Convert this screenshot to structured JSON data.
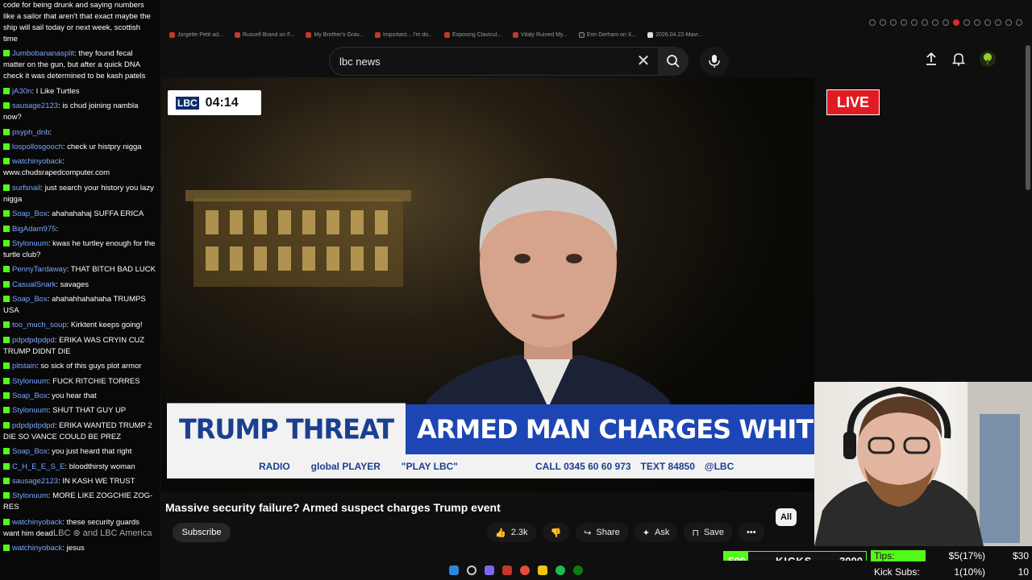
{
  "browser": {
    "bookmarks": [
      "Jorgette Petit ad...",
      "Russell Brand on F...",
      "My Brother's Grav...",
      "Important... I'm do...",
      "Exposing Clavicul...",
      "Vitaly Ruined My...",
      "Erin Derham on X...",
      "2026.04.22-Mavr..."
    ]
  },
  "search": {
    "query": "lbc news"
  },
  "video": {
    "lbc_logo": "LBC",
    "timer": "04:14",
    "live_label": "LIVE",
    "lower_third": {
      "tag": "TRUMP THREAT",
      "headline": "ARMED MAN CHARGES WHITE HOUSE DI",
      "radio": "RADIO",
      "player": "global PLAYER",
      "play": "\"PLAY LBC\"",
      "call": "CALL 0345 60 60 973",
      "text": "TEXT 84850",
      "handle": "@LBC"
    }
  },
  "title": "Massive security failure? Armed suspect charges Trump event",
  "channel": "LBC ⊛ and LBC America",
  "actions": {
    "subscribe": "Subscribe",
    "likes": "2.3k",
    "share": "Share",
    "ask": "Ask",
    "save": "Save",
    "filter_all": "All"
  },
  "chat": [
    {
      "user": "",
      "text": "code for being drunk and saying numbers like a sailor that aren't that exact maybe the ship will sail today or next week, scottish time",
      "badge": false
    },
    {
      "user": "Jumbobananasplit",
      "text": "they found fecal matter on the gun, but after a quick DNA check it was determined to be kash patels",
      "badge": true
    },
    {
      "user": "jA30n",
      "text": "I Like Turtles",
      "badge": true
    },
    {
      "user": "sausage2123",
      "text": "is chud joining nambla now?",
      "badge": true
    },
    {
      "user": "psyph_dnb",
      "text": "",
      "badge": true
    },
    {
      "user": "lospollosgooch",
      "text": "check ur histpry nigga",
      "badge": true
    },
    {
      "user": "watchinyoback",
      "text": "www.chudsrapedcomputer.com",
      "badge": true
    },
    {
      "user": "surfsnail",
      "text": "just search your history you lazy nigga",
      "badge": true
    },
    {
      "user": "Soap_Box",
      "text": "ahahahahaj SUFFA ERICA",
      "badge": true
    },
    {
      "user": "BigAdam975",
      "text": "",
      "badge": true
    },
    {
      "user": "Stylonuum",
      "text": "kwas he turtley enough for the turtle club?",
      "badge": true
    },
    {
      "user": "PennyTardaway",
      "text": "THAT BITCH BAD LUCK",
      "badge": true
    },
    {
      "user": "CasualSnark",
      "text": "savages",
      "badge": true
    },
    {
      "user": "Soap_Box",
      "text": "ahahahhahahaha TRUMPS USA",
      "badge": true
    },
    {
      "user": "too_much_soup",
      "text": "Kirktent keeps going!",
      "badge": true
    },
    {
      "user": "pdpdpdpdpd",
      "text": "ERIKA WAS CRYIN CUZ TRUMP DIDNT DIE",
      "badge": true
    },
    {
      "user": "pitstain",
      "text": "so sick of this guys plot armor",
      "badge": true
    },
    {
      "user": "Stylonuum",
      "text": "FUCK RITCHIE TORRES",
      "badge": true
    },
    {
      "user": "Soap_Box",
      "text": "you hear that",
      "badge": true
    },
    {
      "user": "Stylonuum",
      "text": "SHUT THAT GUY UP",
      "badge": true
    },
    {
      "user": "pdpdpdpdpd",
      "text": "ERIKA WANTED TRUMP 2 DIE SO VANCE COULD BE PREZ",
      "badge": true
    },
    {
      "user": "Soap_Box",
      "text": "you just heard that right",
      "badge": true
    },
    {
      "user": "C_H_E_E_S_E",
      "text": "bloodthirsty woman",
      "badge": true
    },
    {
      "user": "sausage2123",
      "text": "IN KASH WE TRUST",
      "badge": true
    },
    {
      "user": "Stylonuum",
      "text": "MORE LIKE ZOGCHIE ZOG-RES",
      "badge": true
    },
    {
      "user": "watchinyoback",
      "text": "these security guards want him dead",
      "badge": true
    },
    {
      "user": "watchinyoback",
      "text": "jesus",
      "badge": true
    }
  ],
  "kicks": {
    "start": "500",
    "label": "KICKS",
    "goal": "3000",
    "progress": 0.1
  },
  "stats": [
    {
      "label": "Tips:",
      "mid": "$5(17%)",
      "right": "$30"
    },
    {
      "label": "Kick Subs:",
      "mid": "1(10%)",
      "right": "10"
    }
  ],
  "colors": {
    "kick_green": "#53fc18",
    "live_red": "#e01b24",
    "lbc_blue": "#1d46b4",
    "chat_user": "#7aa7ff"
  }
}
